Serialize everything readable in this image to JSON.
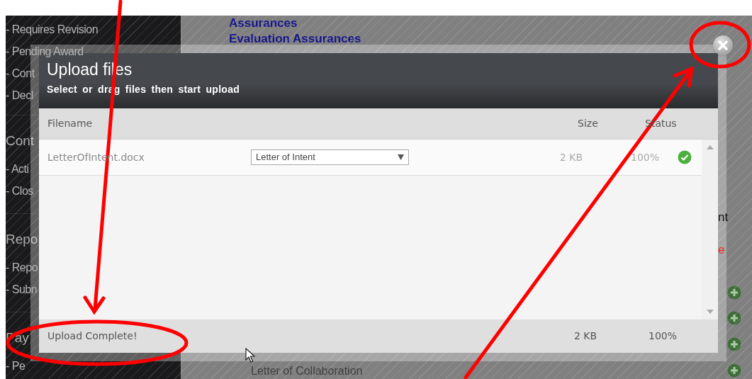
{
  "sidebar": {
    "groups": [
      {
        "items": [
          "- Requires Revision",
          "- Pending Award",
          "- Cont",
          "- Decl"
        ]
      },
      {
        "heading": "Cont",
        "items": [
          "- Acti",
          "- Clos"
        ]
      },
      {
        "heading": "Repo",
        "items": [
          "- Repo",
          "- Subn"
        ]
      },
      {
        "heading": "Pay",
        "items": [
          "- Pe"
        ]
      }
    ]
  },
  "content": {
    "links": [
      {
        "text": "Assurances"
      },
      {
        "text": "Evaluation Assurances"
      }
    ],
    "fragments": [
      {
        "text": "nt",
        "kind": "plain"
      },
      {
        "text": "e",
        "kind": "alert"
      }
    ],
    "bottom_text": "Letter of Collaboration"
  },
  "dialog": {
    "title": "Upload files",
    "subtitle": "Select or drag files then start upload",
    "columns": [
      "Filename",
      "Size",
      "Status"
    ],
    "files": [
      {
        "filename": "LetterOfIntent.docx",
        "type": "Letter of Intent",
        "size": "2 KB",
        "progress": "100%",
        "complete": true
      }
    ],
    "footer": {
      "message": "Upload Complete!",
      "size": "2 KB",
      "progress": "100%"
    }
  }
}
